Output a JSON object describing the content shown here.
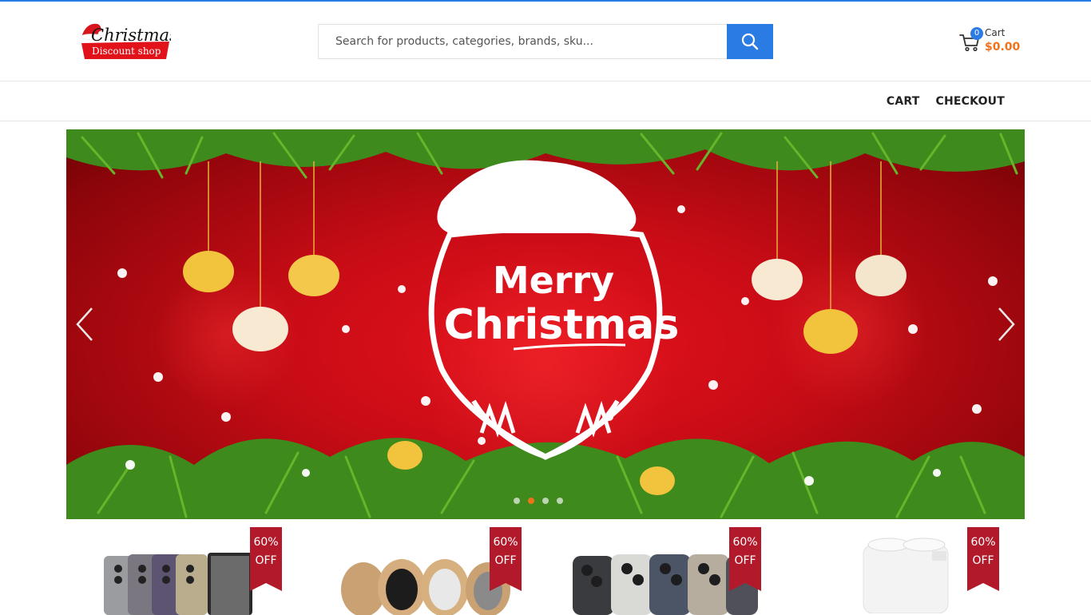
{
  "brand": {
    "logo_line1": "Christmas",
    "logo_line2": "Discount shop"
  },
  "search": {
    "placeholder": "Search for products, categories, brands, sku..."
  },
  "cart": {
    "label": "Cart",
    "count": "0",
    "total": "$0.00"
  },
  "nav": {
    "items": [
      {
        "label": "CART"
      },
      {
        "label": "CHECKOUT"
      }
    ]
  },
  "banner": {
    "headline_line1": "Merry",
    "headline_line2": "Christmas",
    "slide_count": 4,
    "active_slide": 1
  },
  "products": [
    {
      "badge_pct": "60%",
      "badge_off": "OFF",
      "image": "phones-icon"
    },
    {
      "badge_pct": "60%",
      "badge_off": "OFF",
      "image": "filament-spools-icon"
    },
    {
      "badge_pct": "60%",
      "badge_off": "OFF",
      "image": "iphones-icon"
    },
    {
      "badge_pct": "60%",
      "badge_off": "OFF",
      "image": "white-appliance-icon"
    }
  ],
  "colors": {
    "accent": "#2a7be4",
    "price": "#f0731c",
    "badge": "#b21a2b",
    "banner_red": "#d3101a"
  }
}
